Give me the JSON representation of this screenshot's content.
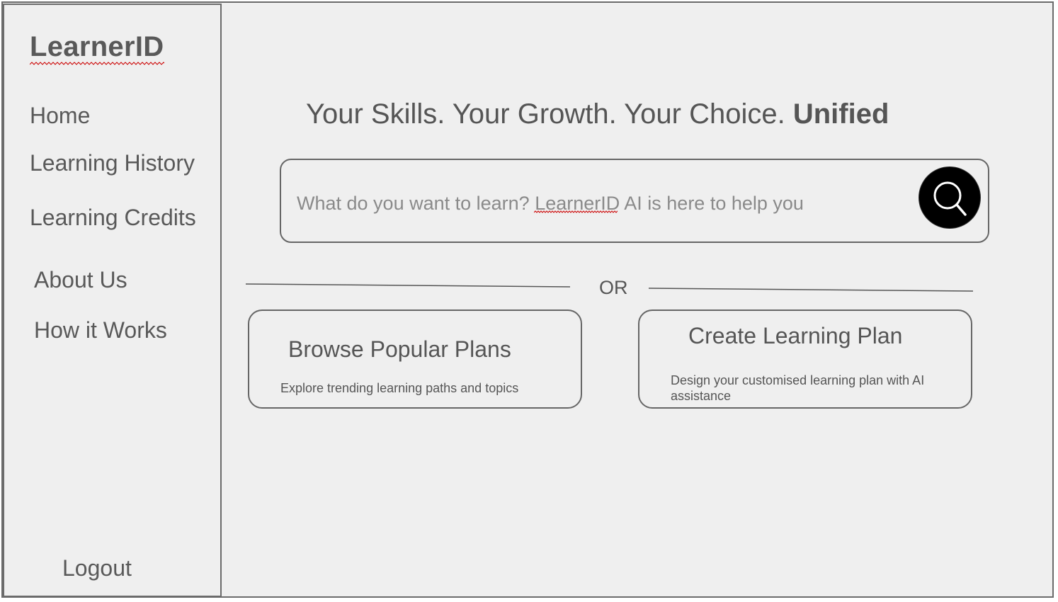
{
  "app": {
    "logo": "LearnerID"
  },
  "sidebar": {
    "items": [
      {
        "label": "Home"
      },
      {
        "label": "Learning History"
      },
      {
        "label": "Learning Credits"
      },
      {
        "label": "About Us"
      },
      {
        "label": "How it Works"
      }
    ],
    "logout_label": "Logout"
  },
  "main": {
    "headline_text": "Your Skills. Your Growth. Your Choice.",
    "headline_emphasis": "Unified",
    "search": {
      "placeholder": "What do you want to learn? LearnerID AI is here to help you",
      "button_icon": "search-icon"
    },
    "divider_label": "OR",
    "cards": [
      {
        "title": "Browse Popular Plans",
        "description": "Explore trending learning paths and topics"
      },
      {
        "title": "Create Learning Plan",
        "description": "Design your customised learning plan with AI assistance"
      }
    ]
  },
  "colors": {
    "background": "#efefef",
    "border": "#666666",
    "text": "#555555",
    "placeholder": "#8a8a8a",
    "search_button": "#000000",
    "spellcheck": "#cc0000"
  }
}
